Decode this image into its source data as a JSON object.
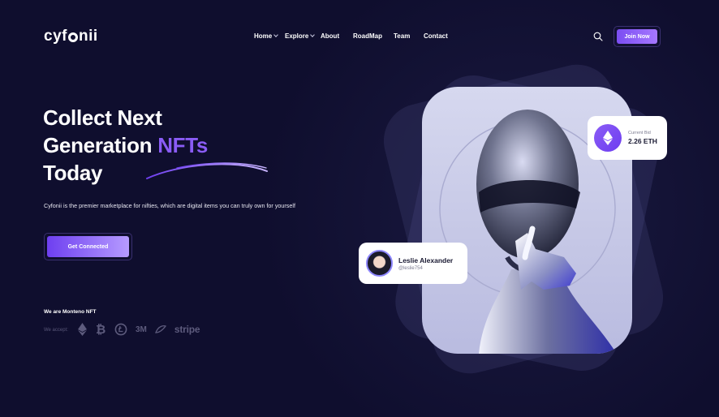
{
  "header": {
    "logo": {
      "pre": "cyf",
      "post": "nii"
    },
    "nav": [
      {
        "label": "Home",
        "has_dropdown": true
      },
      {
        "label": "Explore",
        "has_dropdown": true
      },
      {
        "label": "About",
        "has_dropdown": false
      },
      {
        "label": "RoadMap",
        "has_dropdown": false
      },
      {
        "label": "Team",
        "has_dropdown": false
      },
      {
        "label": "Contact",
        "has_dropdown": false
      }
    ],
    "search_icon": "search-icon",
    "join_label": "Join Now"
  },
  "hero": {
    "line1": "Collect Next",
    "line2_a": "Generation ",
    "line2_b": "NFTs",
    "line3": "Today",
    "description": "Cyfonii is the premier marketplace for nifties, which are digital items you can truly own for yourself",
    "cta_label": "Get Connected"
  },
  "brand": {
    "we_are": "We are Monteno NFT",
    "we_accept": "We accept:",
    "icons": [
      "ethereum-icon",
      "bitcoin-icon",
      "litecoin-icon"
    ],
    "text_logos": [
      "3M",
      "stripe"
    ]
  },
  "art": {
    "bid_label": "Current Bid",
    "bid_value": "2.26 ETH",
    "user_name": "Leslie Alexander",
    "user_handle": "@leslie754"
  },
  "colors": {
    "background": "#0f0e2e",
    "accent": "#8a5cf6",
    "button_gradient_start": "#7b4df2",
    "button_gradient_end": "#a678ff"
  }
}
